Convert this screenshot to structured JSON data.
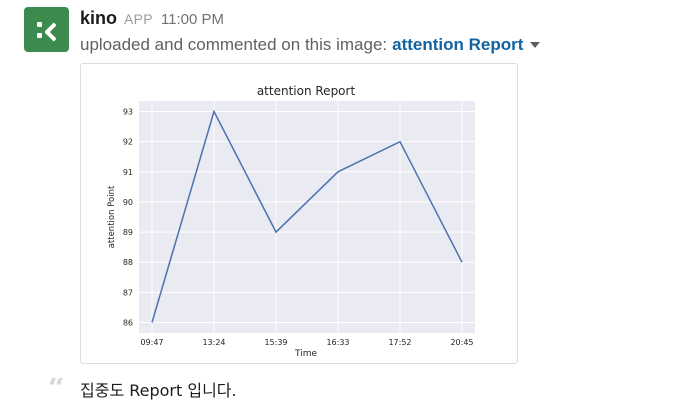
{
  "message": {
    "sender": "kino",
    "app_badge": "APP",
    "timestamp": "11:00 PM",
    "action_text": "uploaded and commented on this image:",
    "file_title": "attention Report",
    "comment": "집중도 Report 입니다."
  },
  "icons": {
    "avatar": "kino-app-logo",
    "caret": "caret-down-icon",
    "quote": "quote-icon"
  },
  "colors": {
    "avatar_bg": "#3d8a4e",
    "link": "#1264a3",
    "plot_bg": "#eaeaf2",
    "line": "#4c72b0"
  },
  "chart_data": {
    "type": "line",
    "title": "attention Report",
    "xlabel": "Time",
    "ylabel": "attention Point",
    "categories": [
      "09:47",
      "13:24",
      "15:39",
      "16:33",
      "17:52",
      "20:45"
    ],
    "values": [
      86,
      93,
      89,
      91,
      92,
      88
    ],
    "yticks": [
      86,
      87,
      88,
      89,
      90,
      91,
      92,
      93
    ],
    "ylim": [
      85.65,
      93.35
    ],
    "grid": true
  }
}
